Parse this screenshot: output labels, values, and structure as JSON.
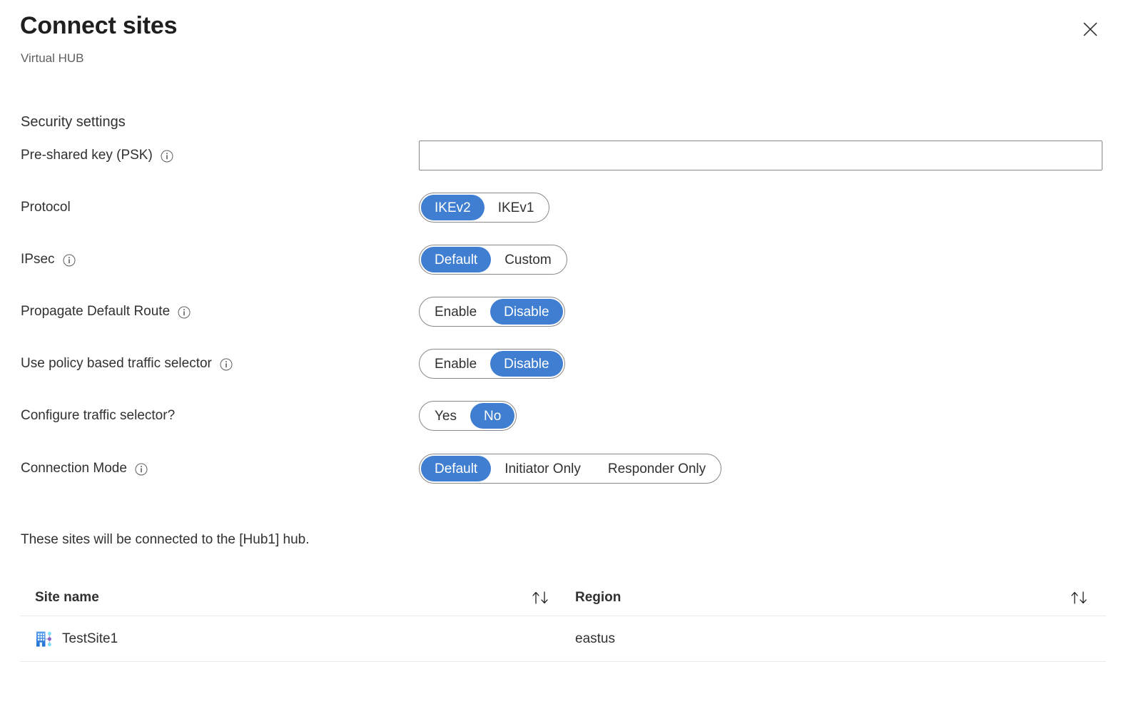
{
  "header": {
    "title": "Connect sites",
    "subtitle": "Virtual HUB",
    "close_icon": "close-icon"
  },
  "colors": {
    "accent_blue": "#3f7ed0",
    "border_gray": "#8a8886",
    "text_primary": "#323130",
    "text_secondary": "#605e5c",
    "row_divider": "#edebe9"
  },
  "form": {
    "section_title": "Security settings",
    "fields": [
      {
        "label": "Pre-shared key (PSK)",
        "has_info": true,
        "control": "text",
        "value": "",
        "placeholder": ""
      },
      {
        "label": "Protocol",
        "has_info": false,
        "control": "pills",
        "options": [
          "IKEv2",
          "IKEv1"
        ],
        "selected": "IKEv2"
      },
      {
        "label": "IPsec",
        "has_info": true,
        "control": "pills",
        "options": [
          "Default",
          "Custom"
        ],
        "selected": "Default"
      },
      {
        "label": "Propagate Default Route",
        "has_info": true,
        "control": "pills",
        "options": [
          "Enable",
          "Disable"
        ],
        "selected": "Disable"
      },
      {
        "label": "Use policy based traffic selector",
        "has_info": true,
        "control": "pills",
        "options": [
          "Enable",
          "Disable"
        ],
        "selected": "Disable"
      },
      {
        "label": "Configure traffic selector?",
        "has_info": false,
        "control": "pills",
        "options": [
          "Yes",
          "No"
        ],
        "selected": "No"
      },
      {
        "label": "Connection Mode",
        "has_info": true,
        "control": "pills",
        "options": [
          "Default",
          "Initiator Only",
          "Responder Only"
        ],
        "selected": "Default"
      }
    ]
  },
  "sites": {
    "note": "These sites will be connected to the [Hub1] hub.",
    "columns": [
      {
        "label": "Site name",
        "sort_icon": "sort-ascending-descending-icon"
      },
      {
        "label": "Region",
        "sort_icon": "sort-ascending-descending-icon"
      }
    ],
    "rows": [
      {
        "site_name": "TestSite1",
        "region": "eastus",
        "icon": "vpn-site-icon"
      }
    ]
  }
}
